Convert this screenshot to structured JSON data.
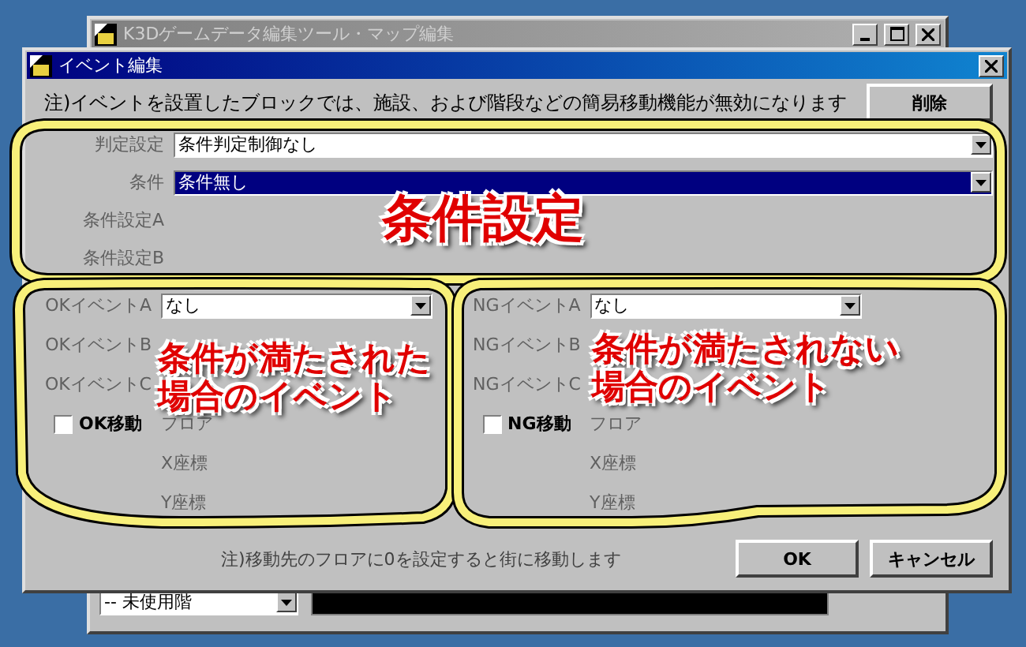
{
  "background_window": {
    "title": "K3Dゲームデータ編集ツール・マップ編集",
    "floor_select": {
      "value": "-- 未使用階"
    }
  },
  "dialog": {
    "title": "イベント編集",
    "note": "注)イベントを設置したブロックでは、施設、および階段などの簡易移動機能が無効になります",
    "delete_button": "削除",
    "condition_rows": [
      {
        "label": "判定設定",
        "kind": "dropdown",
        "value": "条件判定制御なし",
        "highlighted": false
      },
      {
        "label": "条件",
        "kind": "dropdown",
        "value": "条件無し",
        "highlighted": true
      },
      {
        "label": "条件設定A",
        "kind": "empty"
      },
      {
        "label": "条件設定B",
        "kind": "empty"
      }
    ],
    "groups": [
      {
        "events": [
          {
            "label": "OKイベントA",
            "value": "なし"
          },
          {
            "label": "OKイベントB"
          },
          {
            "label": "OKイベントC"
          }
        ],
        "move": {
          "label": "OK移動",
          "checked": false
        },
        "coords": [
          "フロア",
          "X座標",
          "Y座標"
        ]
      },
      {
        "events": [
          {
            "label": "NGイベントA",
            "value": "なし"
          },
          {
            "label": "NGイベントB"
          },
          {
            "label": "NGイベントC"
          }
        ],
        "move": {
          "label": "NG移動",
          "checked": false
        },
        "coords": [
          "フロア",
          "X座標",
          "Y座標"
        ]
      }
    ],
    "footer_note": "注)移動先のフロアに0を設定すると街に移動します",
    "buttons": [
      "OK",
      "キャンセル"
    ]
  },
  "annotations": [
    {
      "lines": [
        "条件設定"
      ]
    },
    {
      "lines": [
        "条件が満たされた",
        "場合のイベント"
      ]
    },
    {
      "lines": [
        "条件が満たされない",
        "場合のイベント"
      ]
    }
  ]
}
